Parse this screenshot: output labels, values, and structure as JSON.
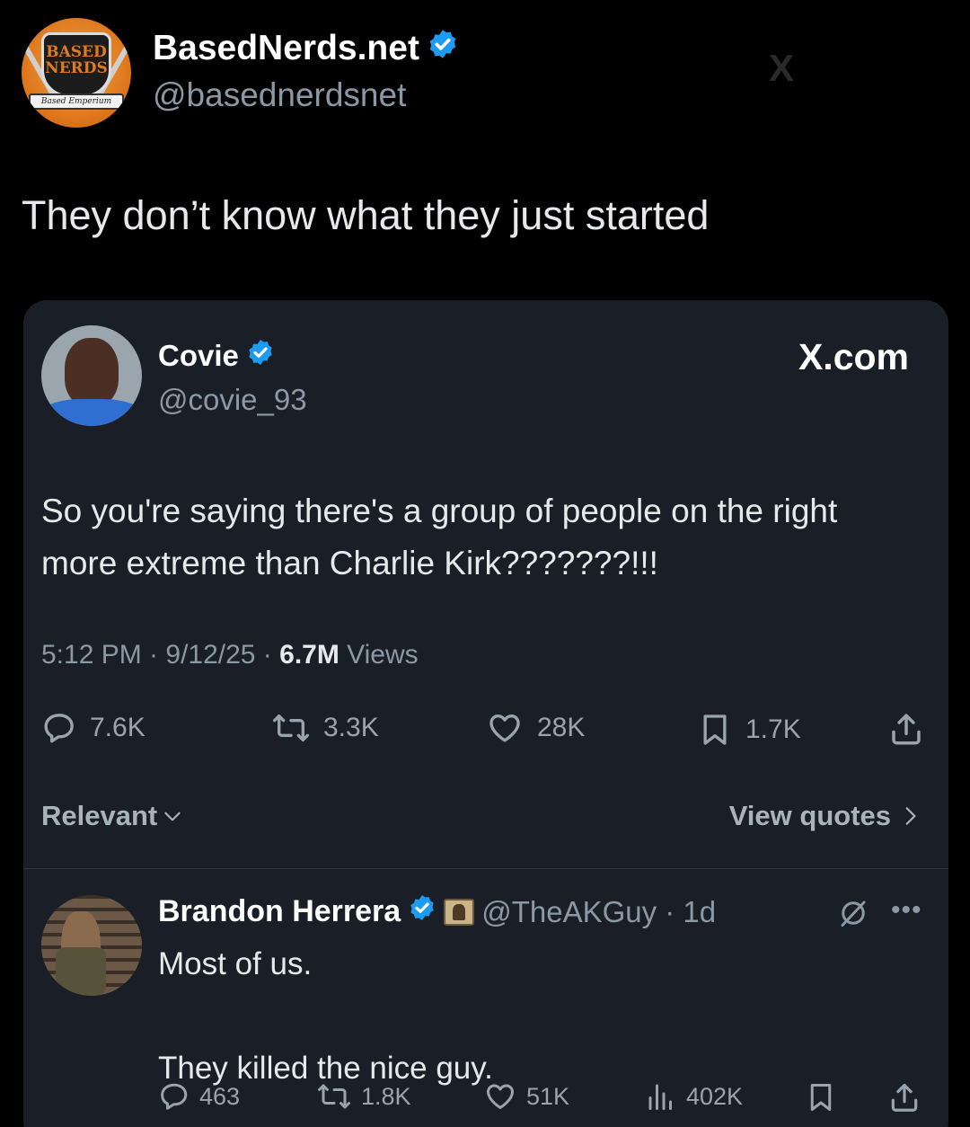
{
  "outer_post": {
    "author_name": "BasedNerds.net",
    "author_handle": "@basednerdsnet",
    "logo_text_top": "BASED",
    "logo_text_bottom": "NERDS",
    "logo_ribbon": "Based Emperium",
    "watermark": "X",
    "text": "They don’t know what they just started"
  },
  "quoted_post": {
    "author_name": "Covie",
    "author_handle": "@covie_93",
    "site_label": "X.com",
    "text": "So you're saying there's a group of people on the right more extreme than Charlie Kirk???????!!!",
    "time": "5:12 PM · 9/12/25 · ",
    "views_count": "6.7M",
    "views_label": " Views",
    "actions": {
      "replies": "7.6K",
      "reposts": "3.3K",
      "likes": "28K",
      "bookmarks": "1.7K"
    },
    "sort_label": "Relevant",
    "view_quotes_label": "View quotes"
  },
  "reply": {
    "author_name": "Brandon Herrera",
    "author_handle": "@TheAKGuy · 1d",
    "text": "Most of us.\n\nThey killed the nice guy.",
    "actions": {
      "replies": "463",
      "reposts": "1.8K",
      "likes": "51K",
      "views": "402K"
    }
  },
  "colors": {
    "background": "#000000",
    "card": "#1a1f27",
    "verified": "#1d9bf0",
    "secondary_text": "#8b98a5"
  }
}
